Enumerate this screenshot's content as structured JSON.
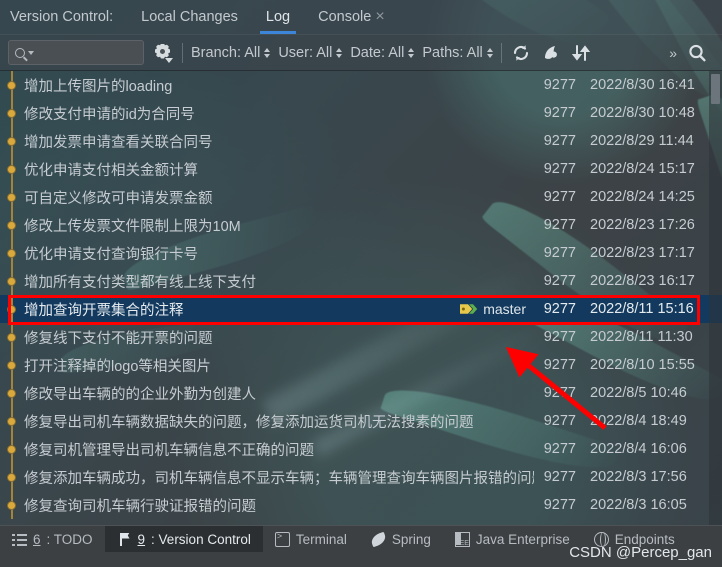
{
  "window": {
    "title_label": "Version Control:",
    "tabs": [
      {
        "label": "Local Changes",
        "active": false,
        "closable": false
      },
      {
        "label": "Log",
        "active": true,
        "closable": false
      },
      {
        "label": "Console",
        "active": false,
        "closable": true,
        "close_glyph": "×"
      }
    ]
  },
  "toolbar": {
    "search_placeholder": "",
    "search_value": "",
    "search_icon": "search-icon",
    "settings_icon": "gear-icon",
    "filters": [
      {
        "name": "branch-filter",
        "label": "Branch: All"
      },
      {
        "name": "user-filter",
        "label": "User: All"
      },
      {
        "name": "date-filter",
        "label": "Date: All"
      },
      {
        "name": "paths-filter",
        "label": "Paths: All"
      }
    ],
    "actions": [
      {
        "name": "refresh-icon",
        "title": "Refresh"
      },
      {
        "name": "intellisort-icon",
        "title": "IntelliSort"
      },
      {
        "name": "collapse-expand-icon",
        "title": "Expand/Collapse"
      }
    ],
    "overflow_label": "»",
    "find_icon": "magnifier-icon"
  },
  "log": {
    "accent_selection": "#133a5e",
    "graph_dot_color": "#d9a93e",
    "rows": [
      {
        "subject": "增加上传图片的loading",
        "ref": "",
        "author": "9277",
        "date": "2022/8/30 16:41",
        "selected": false
      },
      {
        "subject": "修改支付申请的id为合同号",
        "ref": "",
        "author": "9277",
        "date": "2022/8/30 10:48",
        "selected": false
      },
      {
        "subject": "增加发票申请查看关联合同号",
        "ref": "",
        "author": "9277",
        "date": "2022/8/29 11:44",
        "selected": false
      },
      {
        "subject": "优化申请支付相关金额计算",
        "ref": "",
        "author": "9277",
        "date": "2022/8/24 15:17",
        "selected": false
      },
      {
        "subject": "可自定义修改可申请发票金额",
        "ref": "",
        "author": "9277",
        "date": "2022/8/24 14:25",
        "selected": false
      },
      {
        "subject": "修改上传发票文件限制上限为10M",
        "ref": "",
        "author": "9277",
        "date": "2022/8/23 17:26",
        "selected": false
      },
      {
        "subject": "优化申请支付查询银行卡号",
        "ref": "",
        "author": "9277",
        "date": "2022/8/23 17:17",
        "selected": false
      },
      {
        "subject": "增加所有支付类型都有线上线下支付",
        "ref": "",
        "author": "9277",
        "date": "2022/8/23 16:17",
        "selected": false
      },
      {
        "subject": "增加查询开票集合的注释",
        "ref": "master",
        "author": "9277",
        "date": "2022/8/11 15:16",
        "selected": true
      },
      {
        "subject": "修复线下支付不能开票的问题",
        "ref": "",
        "author": "9277",
        "date": "2022/8/11 11:30",
        "selected": false
      },
      {
        "subject": "打开注释掉的logo等相关图片",
        "ref": "",
        "author": "9277",
        "date": "2022/8/10 15:55",
        "selected": false
      },
      {
        "subject": "修改导出车辆的的企业外勤为创建人",
        "ref": "",
        "author": "9277",
        "date": "2022/8/5 10:46",
        "selected": false
      },
      {
        "subject": "修复导出司机车辆数据缺失的问题，修复添加运货司机无法搜素的问题",
        "ref": "",
        "author": "9277",
        "date": "2022/8/4 18:49",
        "selected": false
      },
      {
        "subject": "修复司机管理导出司机车辆信息不正确的问题",
        "ref": "",
        "author": "9277",
        "date": "2022/8/4 16:06",
        "selected": false
      },
      {
        "subject": "修复添加车辆成功，司机车辆信息不显示车辆；车辆管理查询车辆图片报错的问题",
        "ref": "",
        "author": "9277",
        "date": "2022/8/3 17:56",
        "selected": false
      },
      {
        "subject": "修复查询司机车辆行驶证报错的问题",
        "ref": "",
        "author": "9277",
        "date": "2022/8/3 16:05",
        "selected": false
      }
    ]
  },
  "annotations": {
    "highlight_color": "#fe0000",
    "highlight_row_index": 8,
    "arrow_color": "#fe0000"
  },
  "statusbar": {
    "items": [
      {
        "name": "status-todo",
        "icon": "list-icon",
        "number": "6",
        "label": ": TODO",
        "active": false
      },
      {
        "name": "status-version-control",
        "icon": "branch-icon",
        "number": "9",
        "label": ": Version Control",
        "active": true
      },
      {
        "name": "status-terminal",
        "icon": "terminal-icon",
        "number": "",
        "label": "Terminal",
        "active": false
      },
      {
        "name": "status-spring",
        "icon": "spring-leaf-icon",
        "number": "",
        "label": "Spring",
        "active": false
      },
      {
        "name": "status-java-enterprise",
        "icon": "java-ee-icon",
        "number": "",
        "label": "Java Enterprise",
        "active": false
      },
      {
        "name": "status-endpoints",
        "icon": "globe-icon",
        "number": "",
        "label": "Endpoints",
        "active": false
      }
    ]
  },
  "watermark": {
    "text": "CSDN @Percep_gan"
  }
}
